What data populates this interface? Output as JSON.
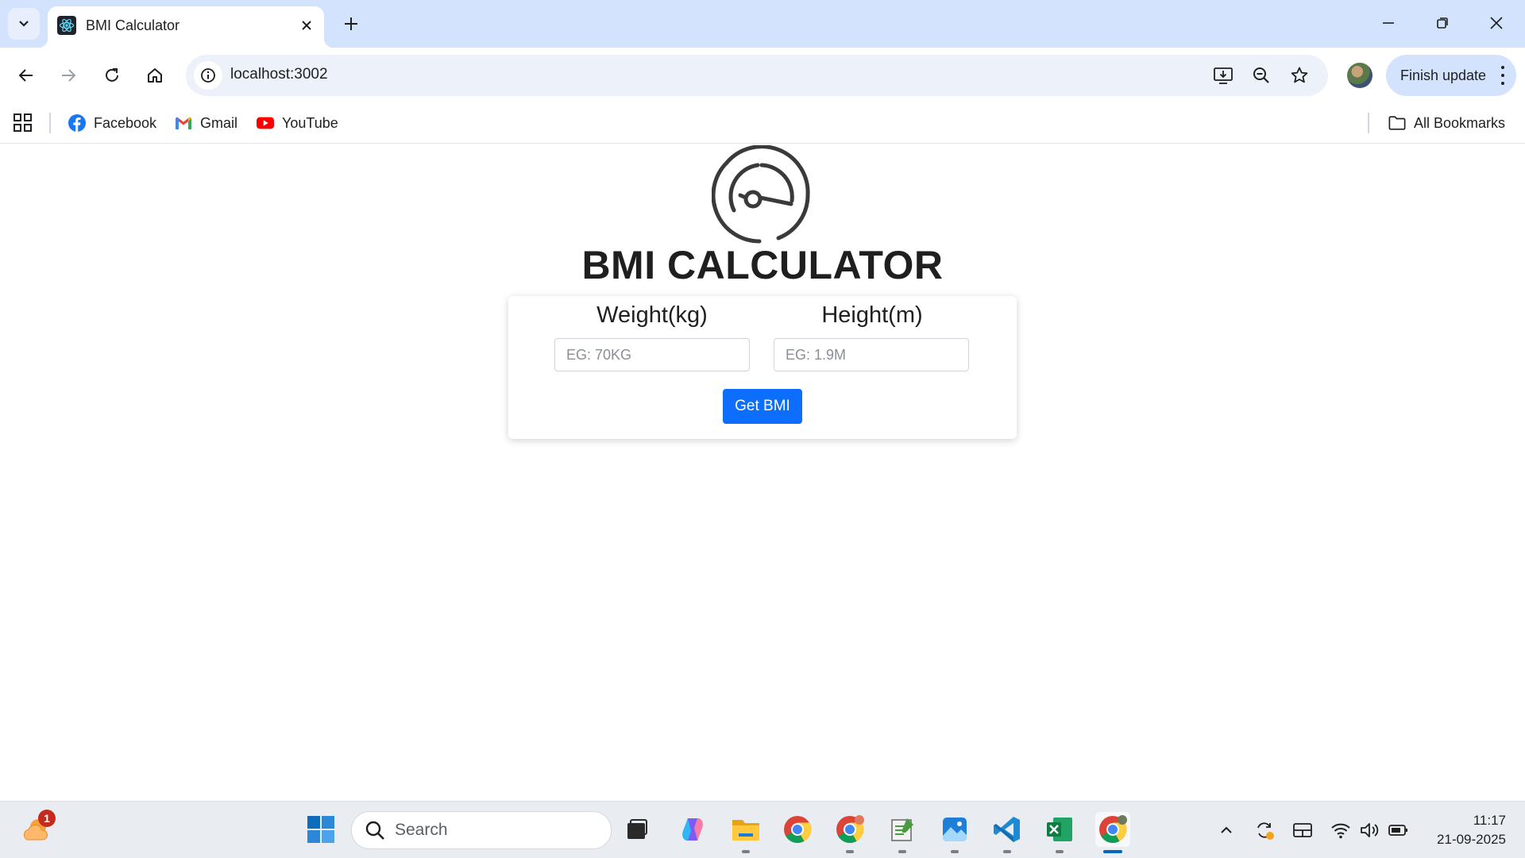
{
  "browser": {
    "tab_title": "BMI Calculator",
    "url": "localhost:3002",
    "update_button": "Finish update",
    "bookmarks": [
      "Facebook",
      "Gmail",
      "YouTube"
    ],
    "all_bookmarks": "All Bookmarks"
  },
  "page": {
    "title": "BMI CALCULATOR",
    "weight_label": "Weight(kg)",
    "weight_placeholder": "EG: 70KG",
    "height_label": "Height(m)",
    "height_placeholder": "EG: 1.9M",
    "button_label": "Get BMI"
  },
  "taskbar": {
    "weather_badge": "1",
    "search_label": "Search",
    "time": "11:17",
    "date": "21-09-2025"
  },
  "colors": {
    "tab_strip": "#d3e3fd",
    "primary_button": "#0d6efd",
    "taskbar": "#e9edf2"
  }
}
